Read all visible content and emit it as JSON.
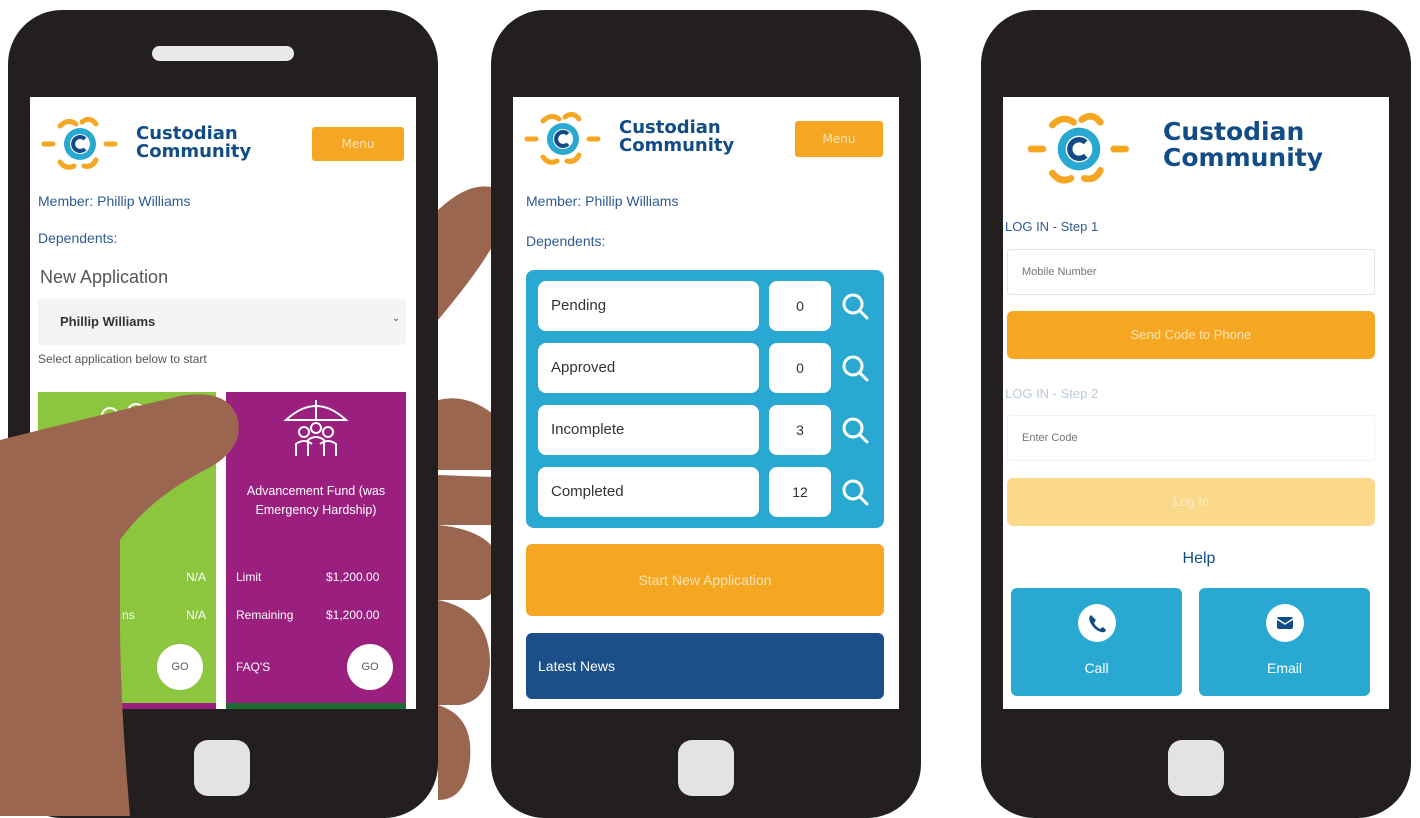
{
  "brand": {
    "line1": "Custodian",
    "line2": "Community"
  },
  "colors": {
    "navy": "#114c86",
    "orange": "#f5a623",
    "cyan": "#29a9d1",
    "green": "#8cc63f",
    "magenta": "#9b1f7e",
    "dark_blue": "#1a4f8a"
  },
  "phone1": {
    "menu_label": "Menu",
    "member": "Member: Phillip Williams",
    "dependents": "Dependents:",
    "new_application": "New Application",
    "select_value": "Phillip Williams",
    "select_hint": "Select application below to start",
    "card_green": {
      "icon": "people-icon",
      "limit_value": "N/A",
      "remaining_value": "N/A",
      "remaining_label_fragment": "ns",
      "go_label": "GO"
    },
    "card_purple": {
      "icon": "umbrella-family-icon",
      "title": "Advancement Fund (was Emergency Hardship)",
      "limit_label": "Limit",
      "limit_value": "$1,200.00",
      "remaining_label": "Remaining",
      "remaining_value": "$1,200.00",
      "faqs_label": "FAQ'S",
      "go_label": "GO"
    }
  },
  "phone2": {
    "menu_label": "Menu",
    "member": "Member: Phillip Williams",
    "dependents": "Dependents:",
    "statuses": [
      {
        "label": "Pending",
        "count": "0"
      },
      {
        "label": "Approved",
        "count": "0"
      },
      {
        "label": "Incomplete",
        "count": "3"
      },
      {
        "label": "Completed",
        "count": "12"
      }
    ],
    "start_button": "Start New Application",
    "latest_news": "Latest News"
  },
  "phone3": {
    "step1_label": "LOG IN - Step 1",
    "mobile_placeholder": "Mobile Number",
    "send_code_button": "Send Code to Phone",
    "step2_label": "LOG IN - Step 2",
    "code_placeholder": "Enter Code",
    "login_button": "Log In",
    "help_heading": "Help",
    "call_label": "Call",
    "email_label": "Email"
  }
}
